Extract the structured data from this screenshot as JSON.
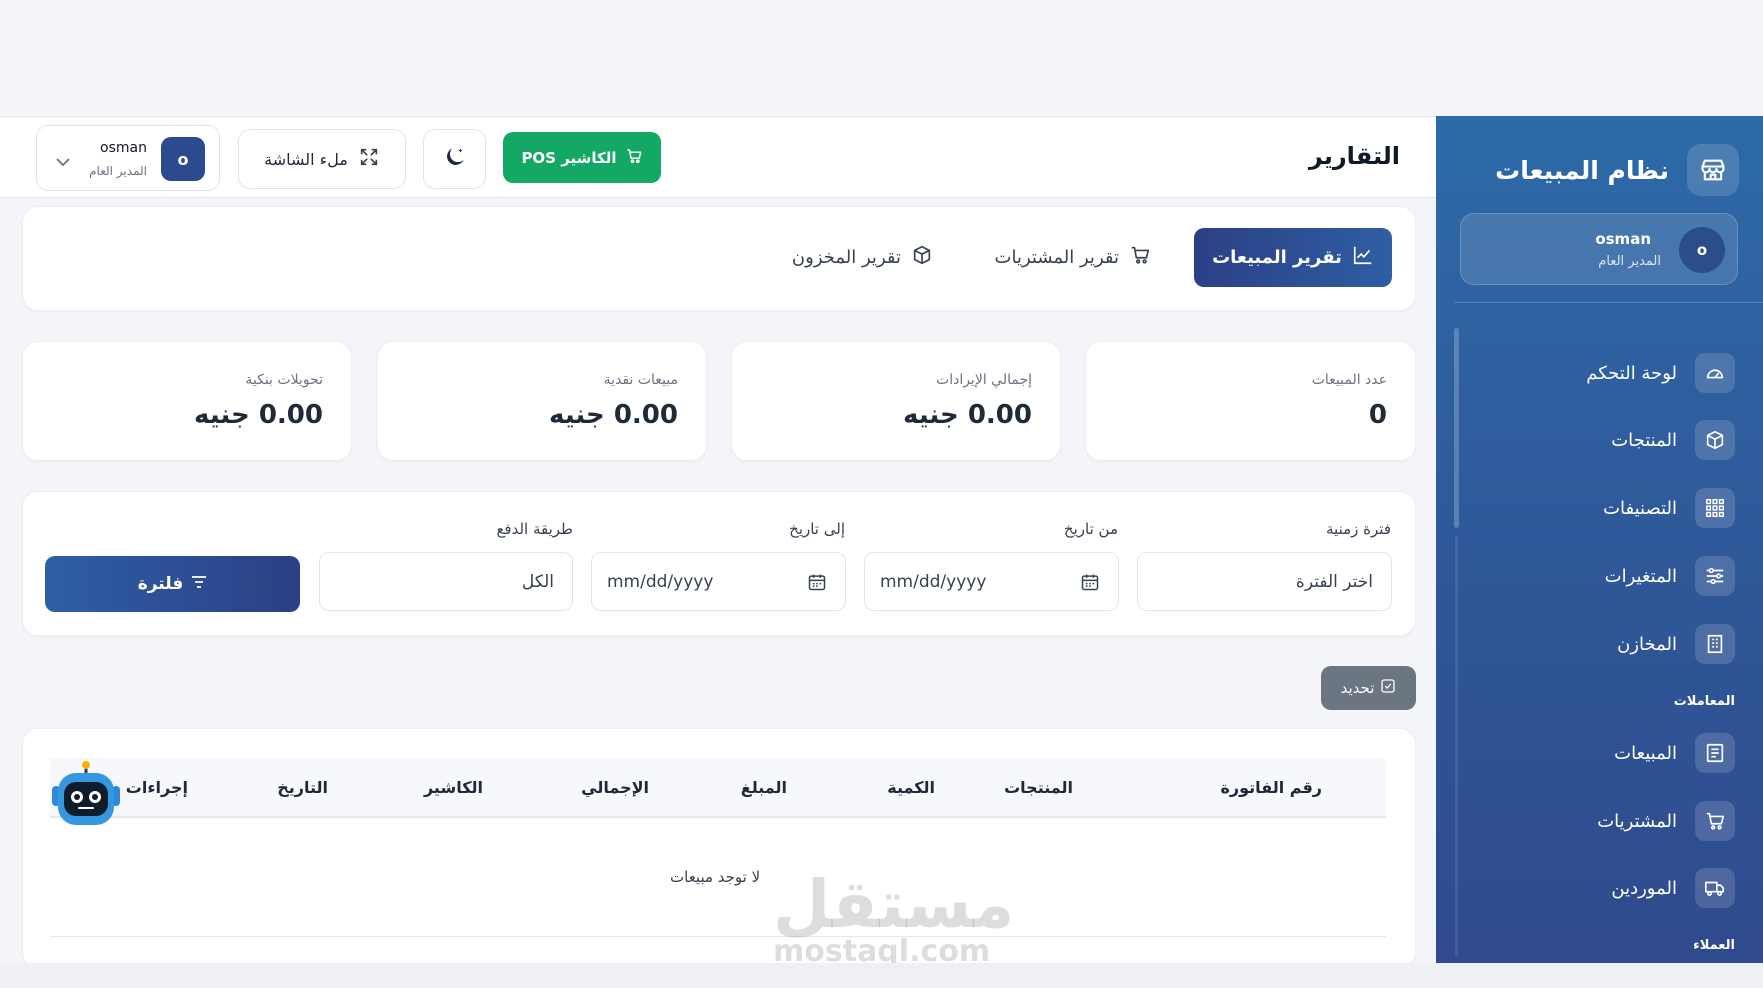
{
  "sidebar": {
    "title": "نظام المبيعات",
    "user": {
      "initial": "o",
      "name": "osman",
      "role": "المدير العام"
    },
    "items": [
      {
        "label": "لوحة التحكم",
        "icon": "dashboard-gauge-icon"
      },
      {
        "label": "المنتجات",
        "icon": "box-icon"
      },
      {
        "label": "التصنيفات",
        "icon": "grid-icon"
      },
      {
        "label": "المتغيرات",
        "icon": "sliders-icon"
      },
      {
        "label": "المخازن",
        "icon": "building-icon"
      }
    ],
    "section_transactions": "المعاملات",
    "transactions": [
      {
        "label": "المبيعات",
        "icon": "receipt-icon"
      },
      {
        "label": "المشتريات",
        "icon": "cart-icon"
      },
      {
        "label": "الموردين",
        "icon": "truck-icon"
      }
    ],
    "section_customers": "العملاء"
  },
  "header": {
    "title": "التقارير",
    "pos_button": "الكاشير POS",
    "fullscreen_button": "ملء الشاشة",
    "user": {
      "initial": "o",
      "name": "osman",
      "role": "المدير العام"
    }
  },
  "tabs": {
    "sales": "تقرير المبيعات",
    "purchases": "تقرير المشتريات",
    "inventory": "تقرير المخزون"
  },
  "stats": [
    {
      "label": "عدد المبيعات",
      "value": "0"
    },
    {
      "label": "إجمالي الإيرادات",
      "value": "0.00 جنيه"
    },
    {
      "label": "مبيعات نقدية",
      "value": "0.00 جنيه"
    },
    {
      "label": "تحويلات بنكية",
      "value": "0.00 جنيه"
    }
  ],
  "filters": {
    "period_label": "فترة زمنية",
    "period_value": "اختر الفترة",
    "from_label": "من تاريخ",
    "from_placeholder": "mm/dd/yyyy",
    "to_label": "إلى تاريخ",
    "to_placeholder": "mm/dd/yyyy",
    "payment_label": "طريقة الدفع",
    "payment_value": "الكل",
    "filter_button": "فلترة"
  },
  "refresh_button": "تحديد",
  "table": {
    "columns": [
      "رقم الفاتورة",
      "المنتجات",
      "الكمية",
      "المبلغ",
      "الإجمالي",
      "الكاشير",
      "التاريخ",
      "إجراءات"
    ],
    "empty_text": "لا توجد مبيعات"
  },
  "watermark": {
    "main": "مستقل",
    "sub": "mostaql.com"
  },
  "colors": {
    "sidebar": "#2f5c9c",
    "pos_green": "#14a865",
    "primary": "#2c3f86"
  }
}
